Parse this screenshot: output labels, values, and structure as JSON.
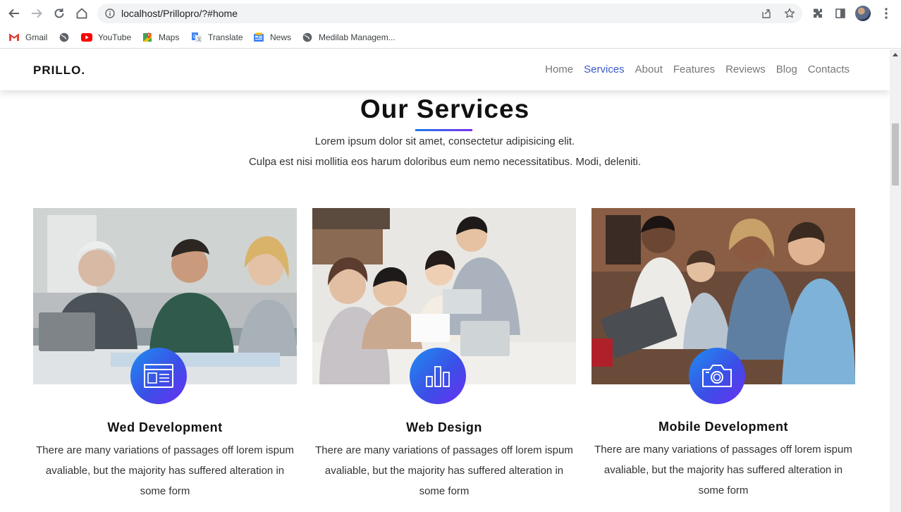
{
  "browser": {
    "url": "localhost/Prillopro/?#home",
    "bookmarks": [
      {
        "label": "Gmail",
        "icon": "gmail-icon"
      },
      {
        "label": "",
        "icon": "globe-icon"
      },
      {
        "label": "YouTube",
        "icon": "youtube-icon"
      },
      {
        "label": "Maps",
        "icon": "maps-icon"
      },
      {
        "label": "Translate",
        "icon": "translate-icon"
      },
      {
        "label": "News",
        "icon": "news-icon"
      },
      {
        "label": "Medilab Managem...",
        "icon": "globe-icon"
      }
    ]
  },
  "site": {
    "logo": "PRILLO.",
    "nav": [
      {
        "label": "Home",
        "active": false
      },
      {
        "label": "Services",
        "active": true
      },
      {
        "label": "About",
        "active": false
      },
      {
        "label": "Features",
        "active": false
      },
      {
        "label": "Reviews",
        "active": false
      },
      {
        "label": "Blog",
        "active": false
      },
      {
        "label": "Contacts",
        "active": false
      }
    ],
    "accent_color": "#3a5bd0"
  },
  "services": {
    "title": "Our Services",
    "subtitle_1": "Lorem ipsum dolor sit amet, consectetur adipisicing elit.",
    "subtitle_2": "Culpa est nisi mollitia eos harum doloribus eum nemo necessitatibus. Modi, deleniti.",
    "cards": [
      {
        "title": "Wed Development",
        "text": "There are many variations of passages off lorem ispum avaliable, but the majority has suffered alteration in some form",
        "icon": "browser-window-icon"
      },
      {
        "title": "Web Design",
        "text": "There are many variations of passages off lorem ispum avaliable, but the majority has suffered alteration in some form",
        "icon": "bar-chart-icon"
      },
      {
        "title": "Mobile Development",
        "text": "There are many variations of passages off lorem ispum avaliable, but the majority has suffered alteration in some form",
        "icon": "camera-icon"
      }
    ]
  }
}
